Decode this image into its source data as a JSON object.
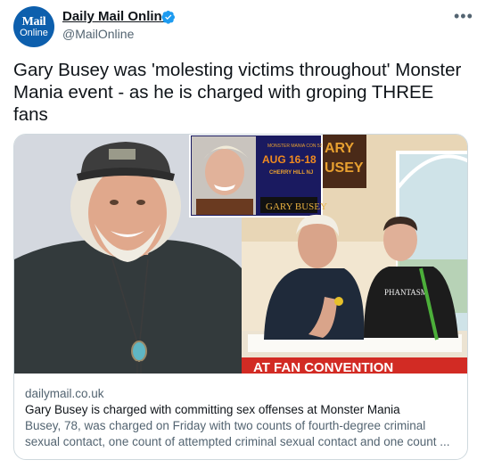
{
  "account": {
    "avatar_line1": "Mail",
    "avatar_line2": "Online",
    "name": "Daily Mail Online",
    "handle": "@MailOnline",
    "verified_icon": "verified-badge-icon",
    "more_icon": "more-options-icon"
  },
  "tweet": {
    "text": "Gary Busey was 'molesting victims throughout' Monster Mania event - as he is charged with groping THREE fans"
  },
  "card": {
    "image_texts": {
      "poster_date": "AUG 16-18",
      "poster_location": "CHERRY HILL NJ",
      "poster_name": "GARY BUSEY",
      "banner_sign": "ARY",
      "banner_sign2": "USEY",
      "shirt_text": "PHANTASM",
      "bottom_banner": "AT FAN CONVENTION"
    },
    "domain": "dailymail.co.uk",
    "title": "Gary Busey is charged with committing sex offenses at Monster Mania",
    "description": "Busey, 78, was charged on Friday with two counts of fourth-degree criminal sexual contact, one count of attempted criminal sexual contact and one count ..."
  },
  "colors": {
    "accent_blue": "#1d9bf0",
    "avatar_blue": "#0d5fad",
    "muted_text": "#536471"
  }
}
